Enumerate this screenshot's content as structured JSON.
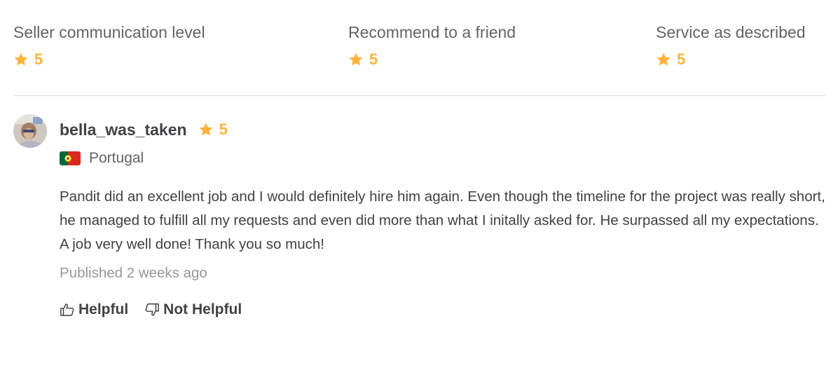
{
  "ratings": [
    {
      "label": "Seller communication level",
      "score": "5"
    },
    {
      "label": "Recommend to a friend",
      "score": "5"
    },
    {
      "label": "Service as described",
      "score": "5"
    }
  ],
  "review": {
    "reviewer_name": "bella_was_taken",
    "score": "5",
    "country": "Portugal",
    "text": "Pandit did an excellent job and I would definitely hire him again. Even though the timeline for the project was really short, he managed to fulfill all my requests and even did more than what I initally asked for. He surpassed all my expectations. A job very well done! Thank you so much!",
    "published": "Published 2 weeks ago"
  },
  "feedback": {
    "helpful_label": "Helpful",
    "not_helpful_label": "Not Helpful"
  },
  "icons": {
    "star": "star-icon",
    "helpful": "thumbs-up-icon",
    "not_helpful": "thumbs-down-icon",
    "flag": "portugal-flag-icon"
  },
  "colors": {
    "star": "#ffb33e",
    "text_primary": "#404145",
    "text_secondary": "#62646a",
    "text_muted": "#95979d",
    "divider": "#dadbdd"
  }
}
